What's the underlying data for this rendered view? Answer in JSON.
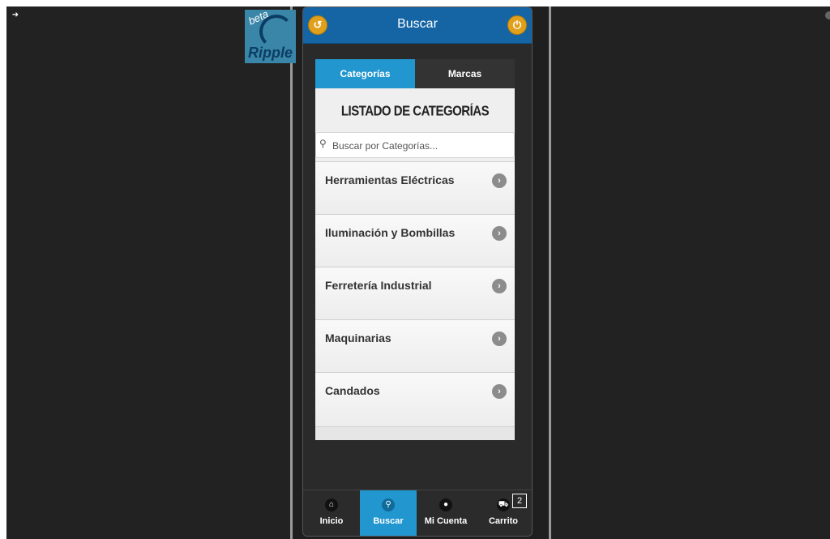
{
  "logo": {
    "beta": "beta",
    "word": "Ripple"
  },
  "topbar": {
    "title": "Buscar"
  },
  "tabs": [
    {
      "label": "Categorías",
      "active": true
    },
    {
      "label": "Marcas",
      "active": false
    }
  ],
  "listing": {
    "title": "LISTADO DE CATEGORÍAS",
    "search_placeholder": "Buscar por Categorías...",
    "items": [
      {
        "label": "Herramientas Eléctricas"
      },
      {
        "label": "Iluminación y Bombillas"
      },
      {
        "label": "Ferretería Industrial"
      },
      {
        "label": "Maquinarias"
      },
      {
        "label": "Candados"
      }
    ]
  },
  "nav": {
    "items": [
      {
        "label": "Inicio",
        "icon": "home-icon",
        "active": false
      },
      {
        "label": "Buscar",
        "icon": "search-icon",
        "active": true
      },
      {
        "label": "Mi Cuenta",
        "icon": "user-icon",
        "active": false
      },
      {
        "label": "Carrito",
        "icon": "cart-icon",
        "active": false
      }
    ],
    "cart_count": "2"
  },
  "colors": {
    "topbar": "#1565a5",
    "accent": "#2196cf",
    "icon_gold": "#e0a01b",
    "background": "#1f1f1f"
  }
}
